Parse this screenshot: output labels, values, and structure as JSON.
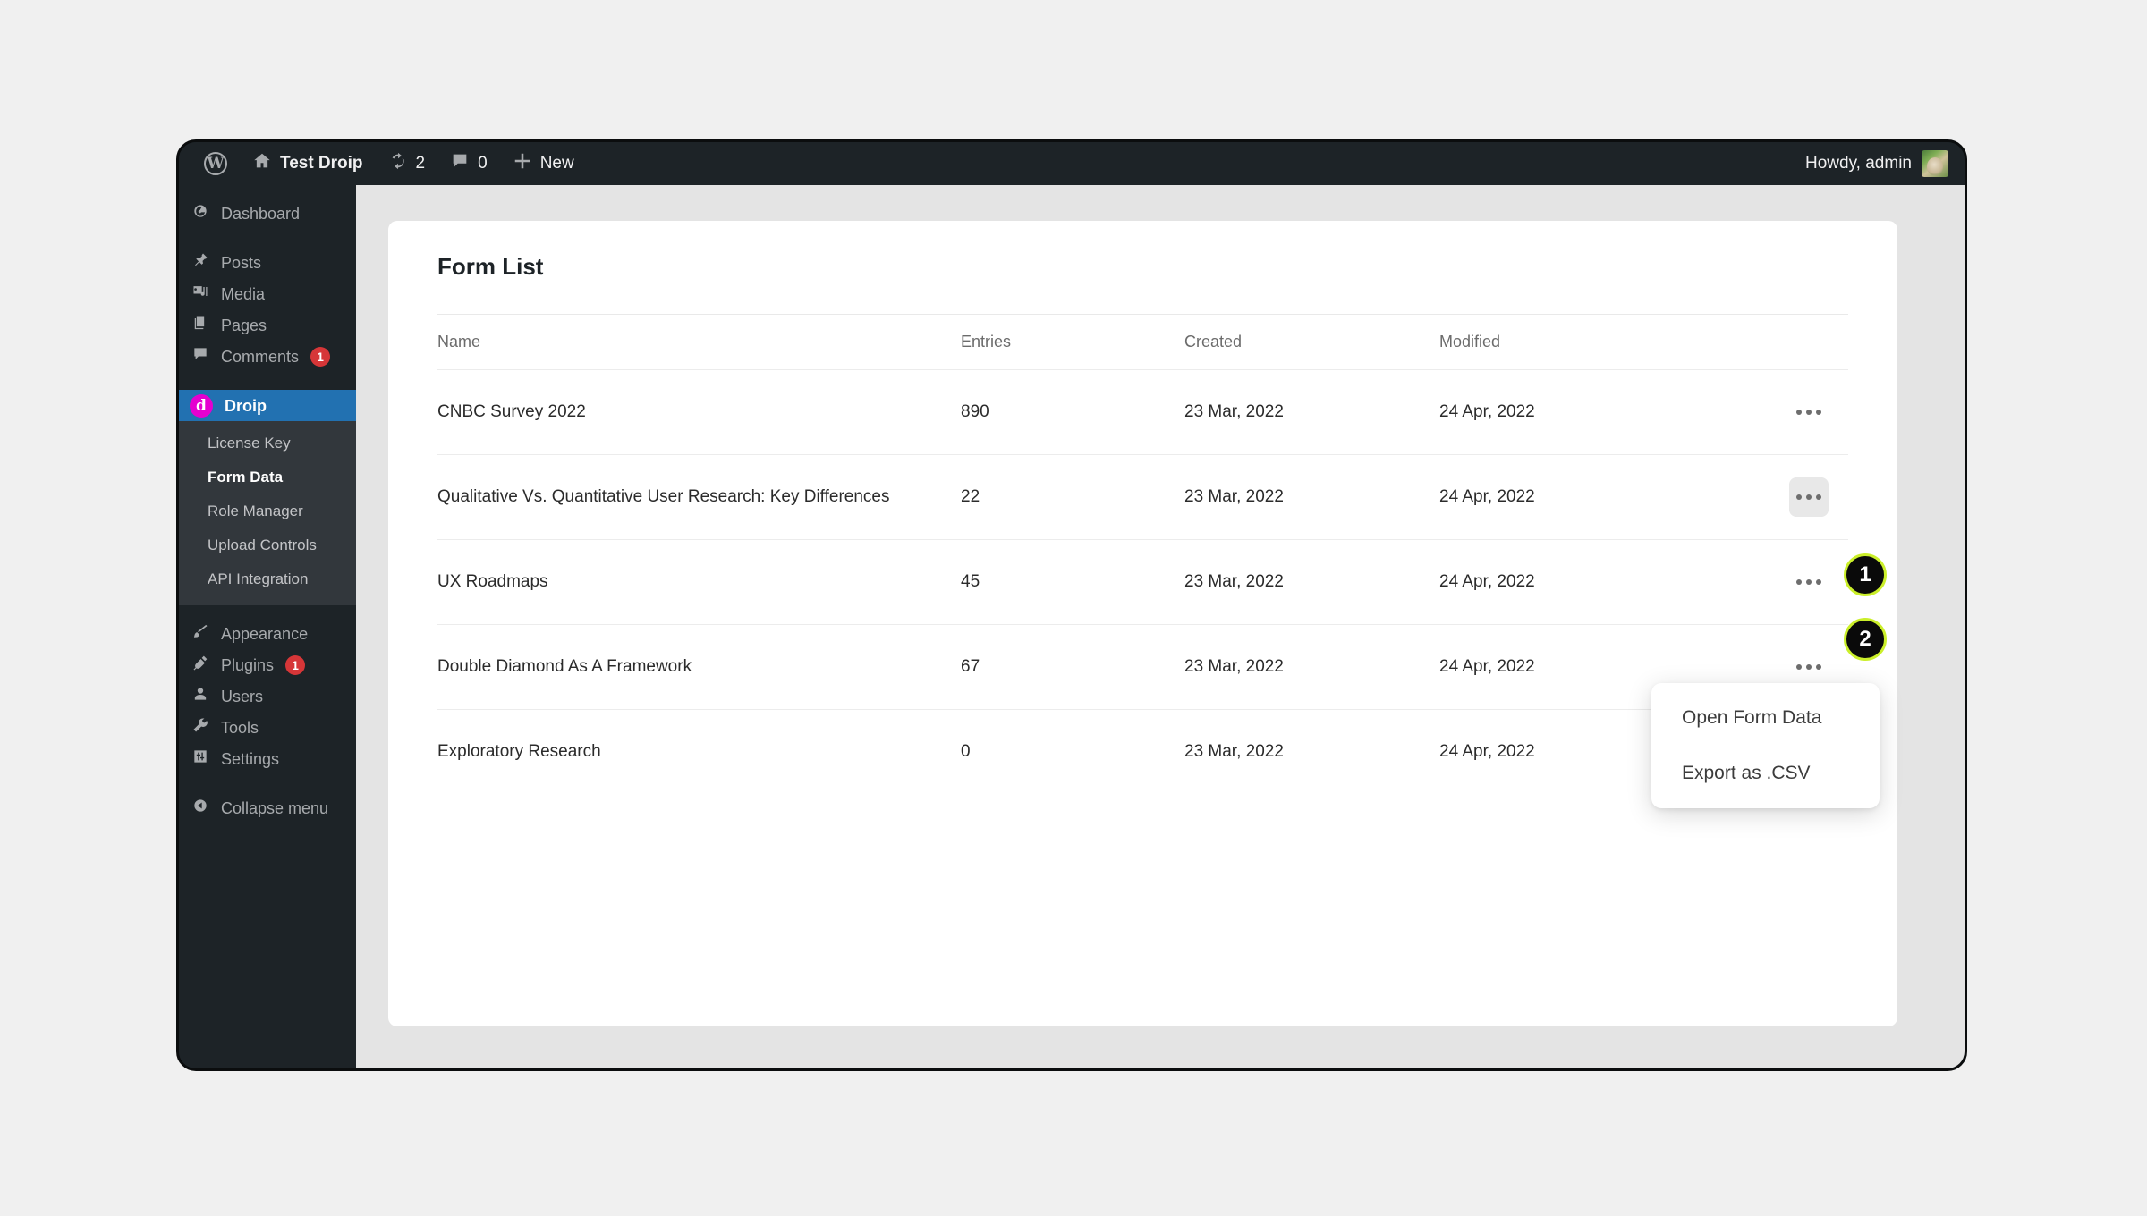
{
  "admin_bar": {
    "wp_logo": "W",
    "site_name": "Test Droip",
    "updates_count": "2",
    "comments_count": "0",
    "new_label": "New",
    "howdy": "Howdy, admin"
  },
  "sidebar": {
    "items": [
      {
        "label": "Dashboard",
        "icon": "dashboard-icon",
        "badge": ""
      },
      {
        "label": "Posts",
        "icon": "pin-icon",
        "badge": ""
      },
      {
        "label": "Media",
        "icon": "media-icon",
        "badge": ""
      },
      {
        "label": "Pages",
        "icon": "pages-icon",
        "badge": ""
      },
      {
        "label": "Comments",
        "icon": "comment-icon",
        "badge": "1"
      },
      {
        "label": "Droip",
        "icon": "droip-logo-icon",
        "badge": ""
      },
      {
        "label": "Appearance",
        "icon": "brush-icon",
        "badge": ""
      },
      {
        "label": "Plugins",
        "icon": "plug-icon",
        "badge": "1"
      },
      {
        "label": "Users",
        "icon": "user-icon",
        "badge": ""
      },
      {
        "label": "Tools",
        "icon": "wrench-icon",
        "badge": ""
      },
      {
        "label": "Settings",
        "icon": "settings-icon",
        "badge": ""
      },
      {
        "label": "Collapse menu",
        "icon": "collapse-icon",
        "badge": ""
      }
    ],
    "droip_logo_letter": "d",
    "submenu": [
      {
        "label": "License Key",
        "current": false
      },
      {
        "label": "Form Data",
        "current": true
      },
      {
        "label": "Role Manager",
        "current": false
      },
      {
        "label": "Upload Controls",
        "current": false
      },
      {
        "label": "API Integration",
        "current": false
      }
    ]
  },
  "main": {
    "card_title": "Form List",
    "table": {
      "columns": [
        "Name",
        "Entries",
        "Created",
        "Modified"
      ],
      "rows": [
        {
          "name": "CNBC Survey 2022",
          "entries": "890",
          "created": "23 Mar, 2022",
          "modified": "24 Apr, 2022"
        },
        {
          "name": "Qualitative Vs. Quantitative User Research: Key Differences",
          "entries": "22",
          "created": "23 Mar, 2022",
          "modified": "24 Apr, 2022"
        },
        {
          "name": "UX Roadmaps",
          "entries": "45",
          "created": "23 Mar, 2022",
          "modified": "24 Apr, 2022"
        },
        {
          "name": " Double Diamond As A Framework",
          "entries": "67",
          "created": "23 Mar, 2022",
          "modified": "24 Apr, 2022"
        },
        {
          "name": "Exploratory Research",
          "entries": "0",
          "created": "23 Mar, 2022",
          "modified": "24 Apr, 2022"
        }
      ]
    }
  },
  "dropdown": {
    "items": [
      {
        "label": "Open Form Data"
      },
      {
        "label": "Export as .CSV"
      }
    ]
  },
  "callouts": [
    {
      "number": "1"
    },
    {
      "number": "2"
    }
  ],
  "colors": {
    "admin_bar_bg": "#1d2327",
    "sidebar_bg": "#1d2327",
    "submenu_bg": "#32373c",
    "active_menu": "#2271b1",
    "droip_brand": "#e500d0",
    "badge_red": "#d63638",
    "content_bg": "#e4e4e4",
    "callout_ring": "#cbef2a",
    "callout_bg": "#0a0a0a"
  }
}
